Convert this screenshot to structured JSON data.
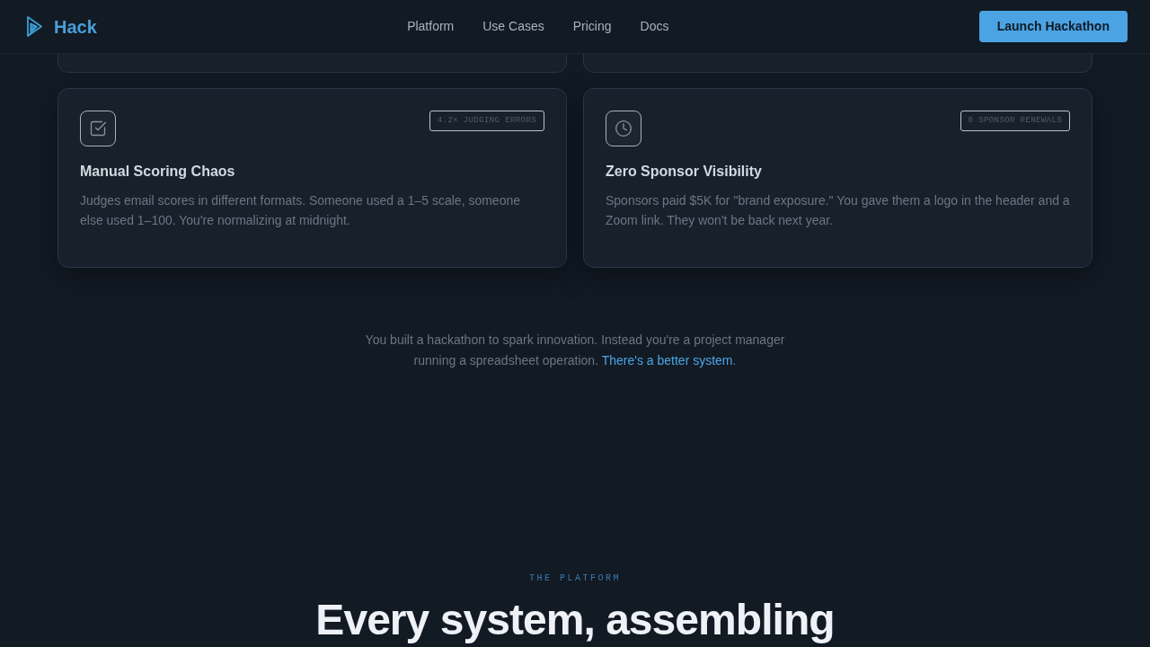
{
  "header": {
    "logo_text": "Hack",
    "nav": [
      "Platform",
      "Use Cases",
      "Pricing",
      "Docs"
    ],
    "cta": "Launch Hackathon"
  },
  "cards": [
    {
      "badge": "4.2× JUDGING ERRORS",
      "title": "Manual Scoring Chaos",
      "description": "Judges email scores in different formats. Someone used a 1–5 scale, someone else used 1–100. You're normalizing at midnight."
    },
    {
      "badge": "0 SPONSOR RENEWALS",
      "title": "Zero Sponsor Visibility",
      "description": "Sponsors paid $5K for \"brand exposure.\" You gave them a logo in the header and a Zoom link. They won't be back next year."
    }
  ],
  "summary": {
    "text": "You built a hackathon to spark innovation. Instead you're a project manager running a spreadsheet operation.",
    "link": "There's a better system",
    "after_link": "."
  },
  "platform": {
    "eyebrow": "THE PLATFORM",
    "heading": "Every system, assembling"
  }
}
